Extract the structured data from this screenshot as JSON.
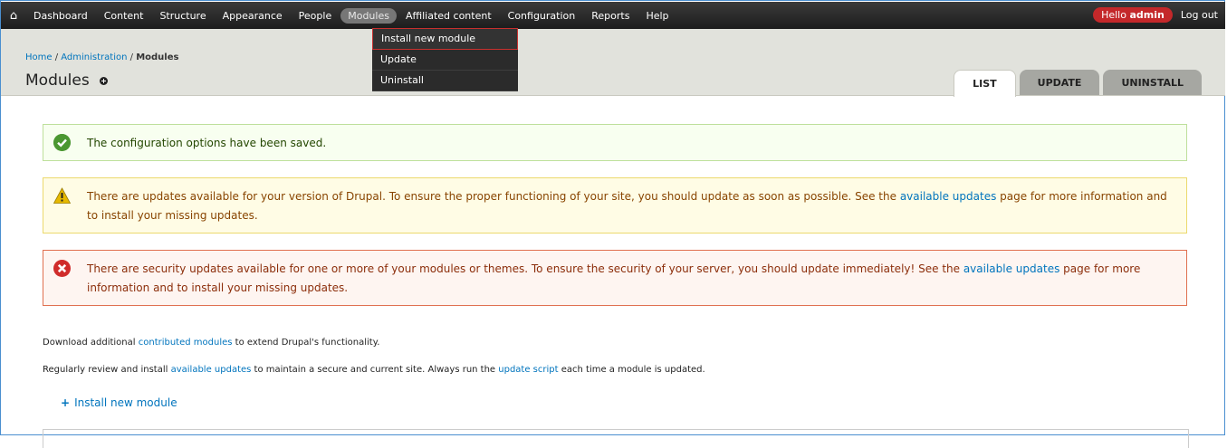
{
  "toolbar": {
    "nav": [
      "Dashboard",
      "Content",
      "Structure",
      "Appearance",
      "People",
      "Modules",
      "Affiliated content",
      "Configuration",
      "Reports",
      "Help"
    ],
    "active_index": 5,
    "hello_prefix": "Hello",
    "user": "admin",
    "logout": "Log out"
  },
  "dropdown": {
    "items": [
      "Install new module",
      "Update",
      "Uninstall"
    ],
    "selected_index": 0
  },
  "breadcrumb": {
    "home": "Home",
    "sep": " / ",
    "admin": "Administration",
    "current": "Modules"
  },
  "page_title": "Modules",
  "tabs": [
    "LIST",
    "UPDATE",
    "UNINSTALL"
  ],
  "messages": {
    "status": "The configuration options have been saved.",
    "warning": {
      "before": "There are updates available for your version of Drupal. To ensure the proper functioning of your site, you should update as soon as possible. See the ",
      "link": "available updates",
      "after": " page for more information and to install your missing updates."
    },
    "error": {
      "before": "There are security updates available for one or more of your modules or themes. To ensure the security of your server, you should update immediately! See the ",
      "link": "available updates",
      "after": " page for more information and to install your missing updates."
    }
  },
  "download_text": {
    "before": "Download additional ",
    "link": "contributed modules",
    "after": " to extend Drupal's functionality."
  },
  "review_text": {
    "before": "Regularly review and install ",
    "link1": "available updates",
    "mid": " to maintain a secure and current site. Always run the ",
    "link2": "update script",
    "after": " each time a module is updated."
  },
  "install_link": "Install new module",
  "colors": {
    "accent_link": "#0074bd",
    "hello_badge": "#c4282a",
    "status_green": "#4b9731",
    "error_red": "#d02c2b",
    "warning_yellow": "#e5b800"
  }
}
